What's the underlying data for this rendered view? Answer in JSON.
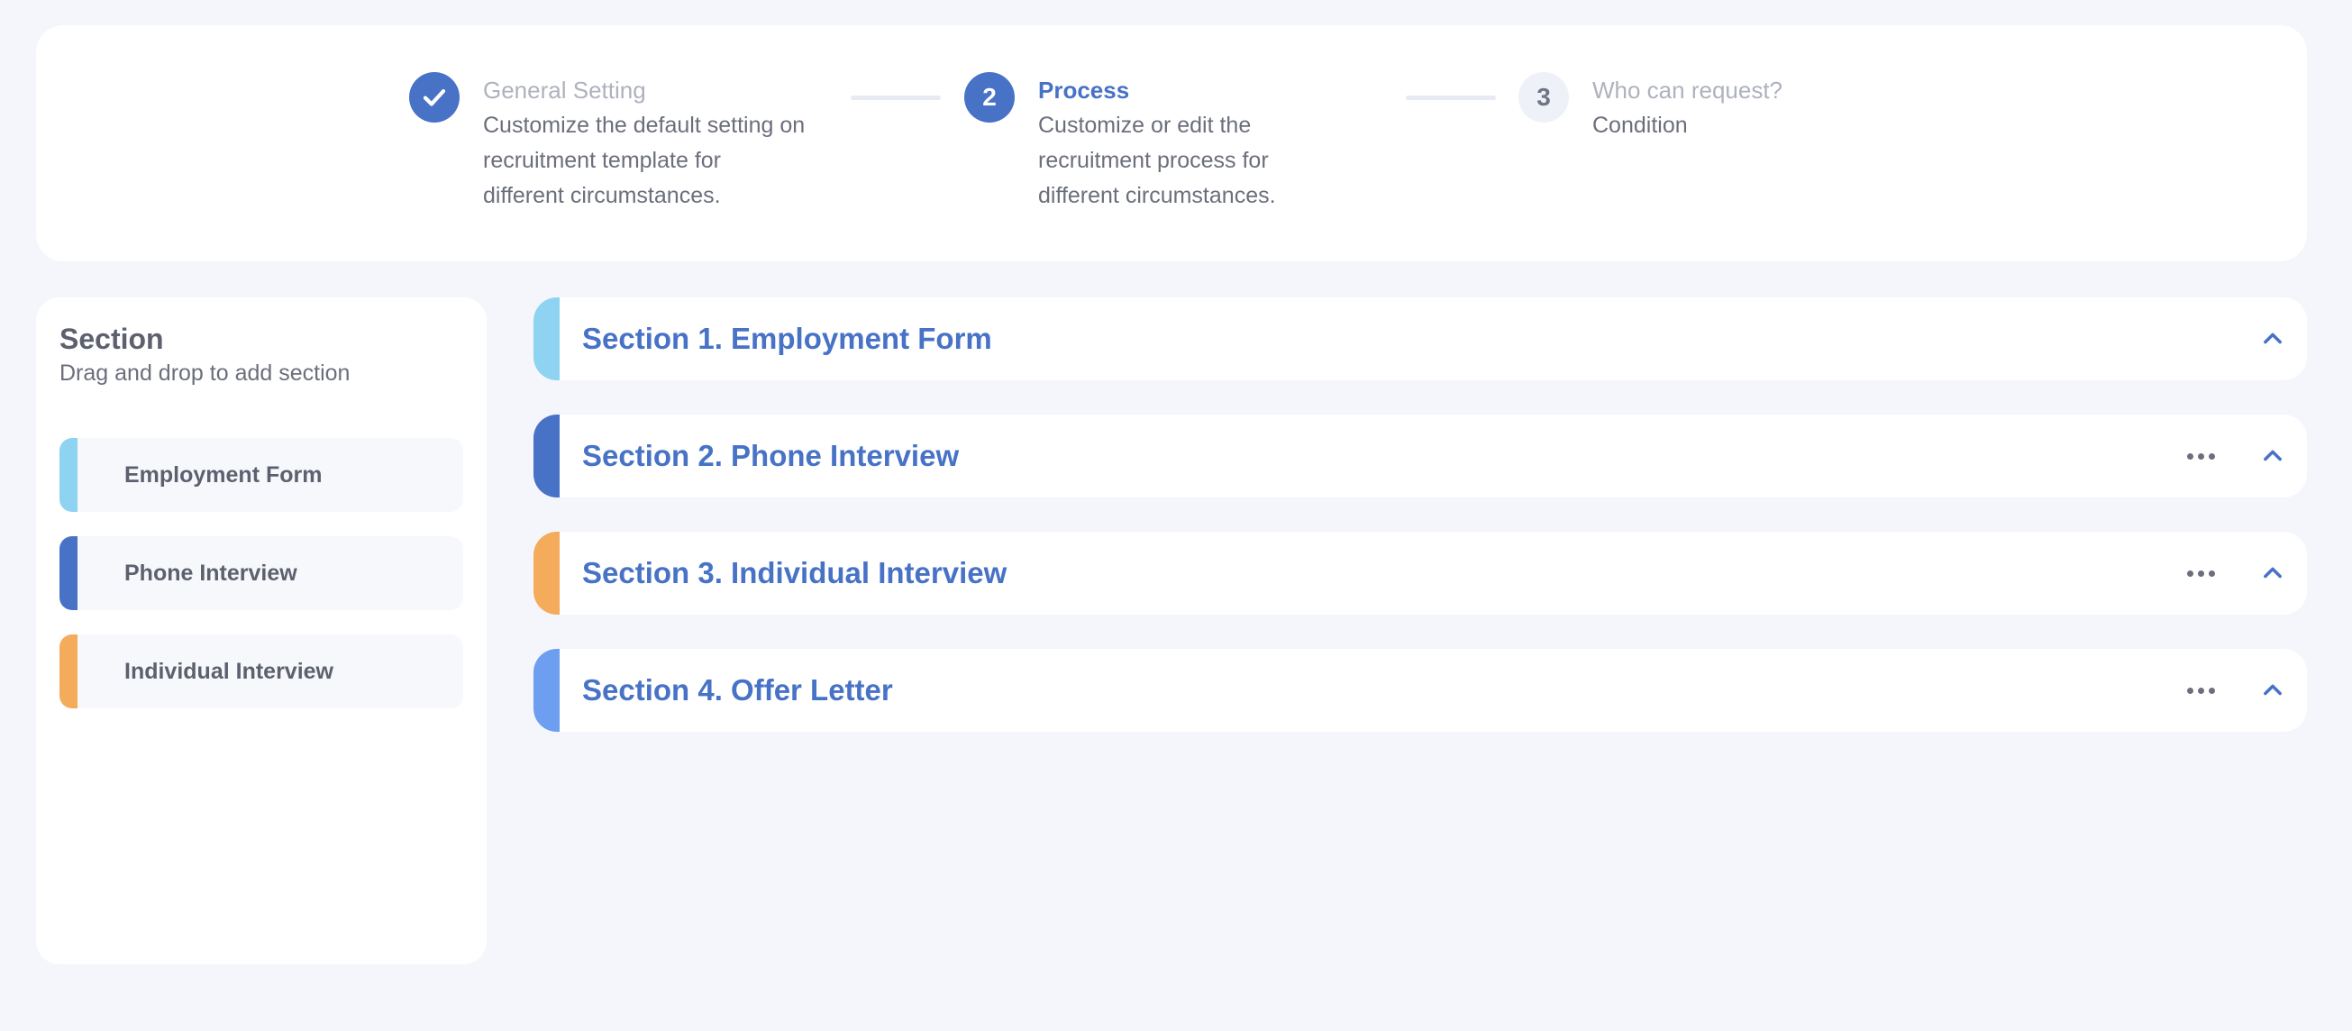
{
  "stepper": {
    "steps": [
      {
        "number": "",
        "status": "done",
        "title": "General Setting",
        "description_lines": [
          "Customize the default setting on",
          "recruitment template for",
          "different circumstances."
        ]
      },
      {
        "number": "2",
        "status": "active",
        "title": "Process",
        "description_lines": [
          "Customize or edit the",
          "recruitment process for",
          "different circumstances."
        ]
      },
      {
        "number": "3",
        "status": "pending",
        "title": "Who can request?",
        "description_lines": [
          "Condition"
        ]
      }
    ]
  },
  "section_panel": {
    "title": "Section",
    "subtitle": "Drag and drop to add section",
    "items": [
      {
        "label": "Employment Form",
        "color": "#8fd3f2"
      },
      {
        "label": "Phone Interview",
        "color": "#4772c6"
      },
      {
        "label": "Individual Interview",
        "color": "#f4ab5c"
      }
    ]
  },
  "sections": [
    {
      "title": "Section 1. Employment Form",
      "color": "#8fd3f2",
      "has_more_menu": false,
      "icons": [
        "chevron-up-icon"
      ]
    },
    {
      "title": "Section 2. Phone Interview",
      "color": "#4772c6",
      "has_more_menu": true,
      "icons": [
        "more-horizontal-icon",
        "chevron-up-icon"
      ]
    },
    {
      "title": "Section 3. Individual Interview",
      "color": "#f4ab5c",
      "has_more_menu": true,
      "icons": [
        "more-horizontal-icon",
        "chevron-up-icon"
      ]
    },
    {
      "title": "Section 4. Offer Letter",
      "color": "#6e9ef0",
      "has_more_menu": true,
      "icons": [
        "more-horizontal-icon",
        "chevron-up-icon"
      ]
    }
  ],
  "colors": {
    "accent": "#4772c6",
    "background": "#f4f6fb",
    "card": "#ffffff",
    "muted_text": "#aeb2bd"
  }
}
